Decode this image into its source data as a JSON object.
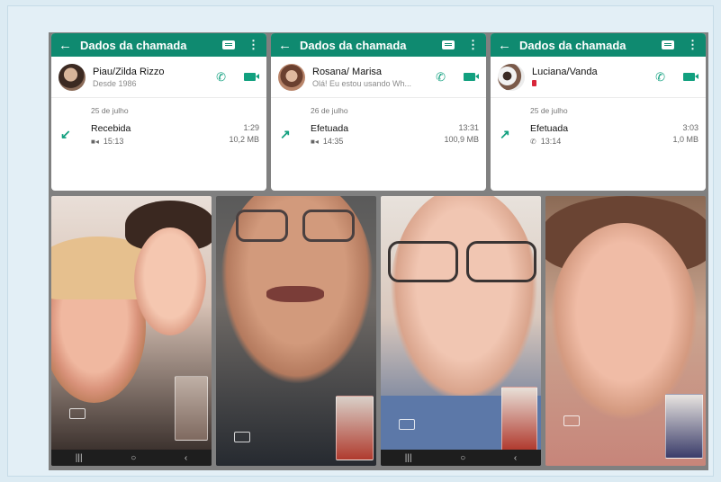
{
  "cards": [
    {
      "title": "Dados da chamada",
      "contact_name": "Piau/Zilda Rizzo",
      "contact_sub": "Desde 1986",
      "date": "25 de julho",
      "direction": "Recebida",
      "arrow": "↙",
      "time": "15:13",
      "call_type_icon": "video-icon",
      "duration": "1:29",
      "size": "10,2 MB"
    },
    {
      "title": "Dados da chamada",
      "contact_name": "Rosana/ Marisa",
      "contact_sub": "Olá! Eu estou usando Wh...",
      "date": "26 de julho",
      "direction": "Efetuada",
      "arrow": "↗",
      "time": "14:35",
      "call_type_icon": "video-icon",
      "duration": "13:31",
      "size": "100,9 MB"
    },
    {
      "title": "Dados da chamada",
      "contact_name": "Luciana/Vanda",
      "contact_sub": "",
      "date": "25 de julho",
      "direction": "Efetuada",
      "arrow": "↗",
      "time": "13:14",
      "call_type_icon": "phone-icon",
      "duration": "3:03",
      "size": "1,0 MB"
    }
  ],
  "icons": {
    "back": "←",
    "more": "⋮",
    "phone": "✆",
    "video_small": "■◂",
    "nav_recent": "|||",
    "nav_home": "○",
    "nav_back": "‹"
  },
  "colors": {
    "appbar": "#0f8a70",
    "accent": "#12a07f",
    "board": "#808080",
    "background": "#dcebf3"
  }
}
